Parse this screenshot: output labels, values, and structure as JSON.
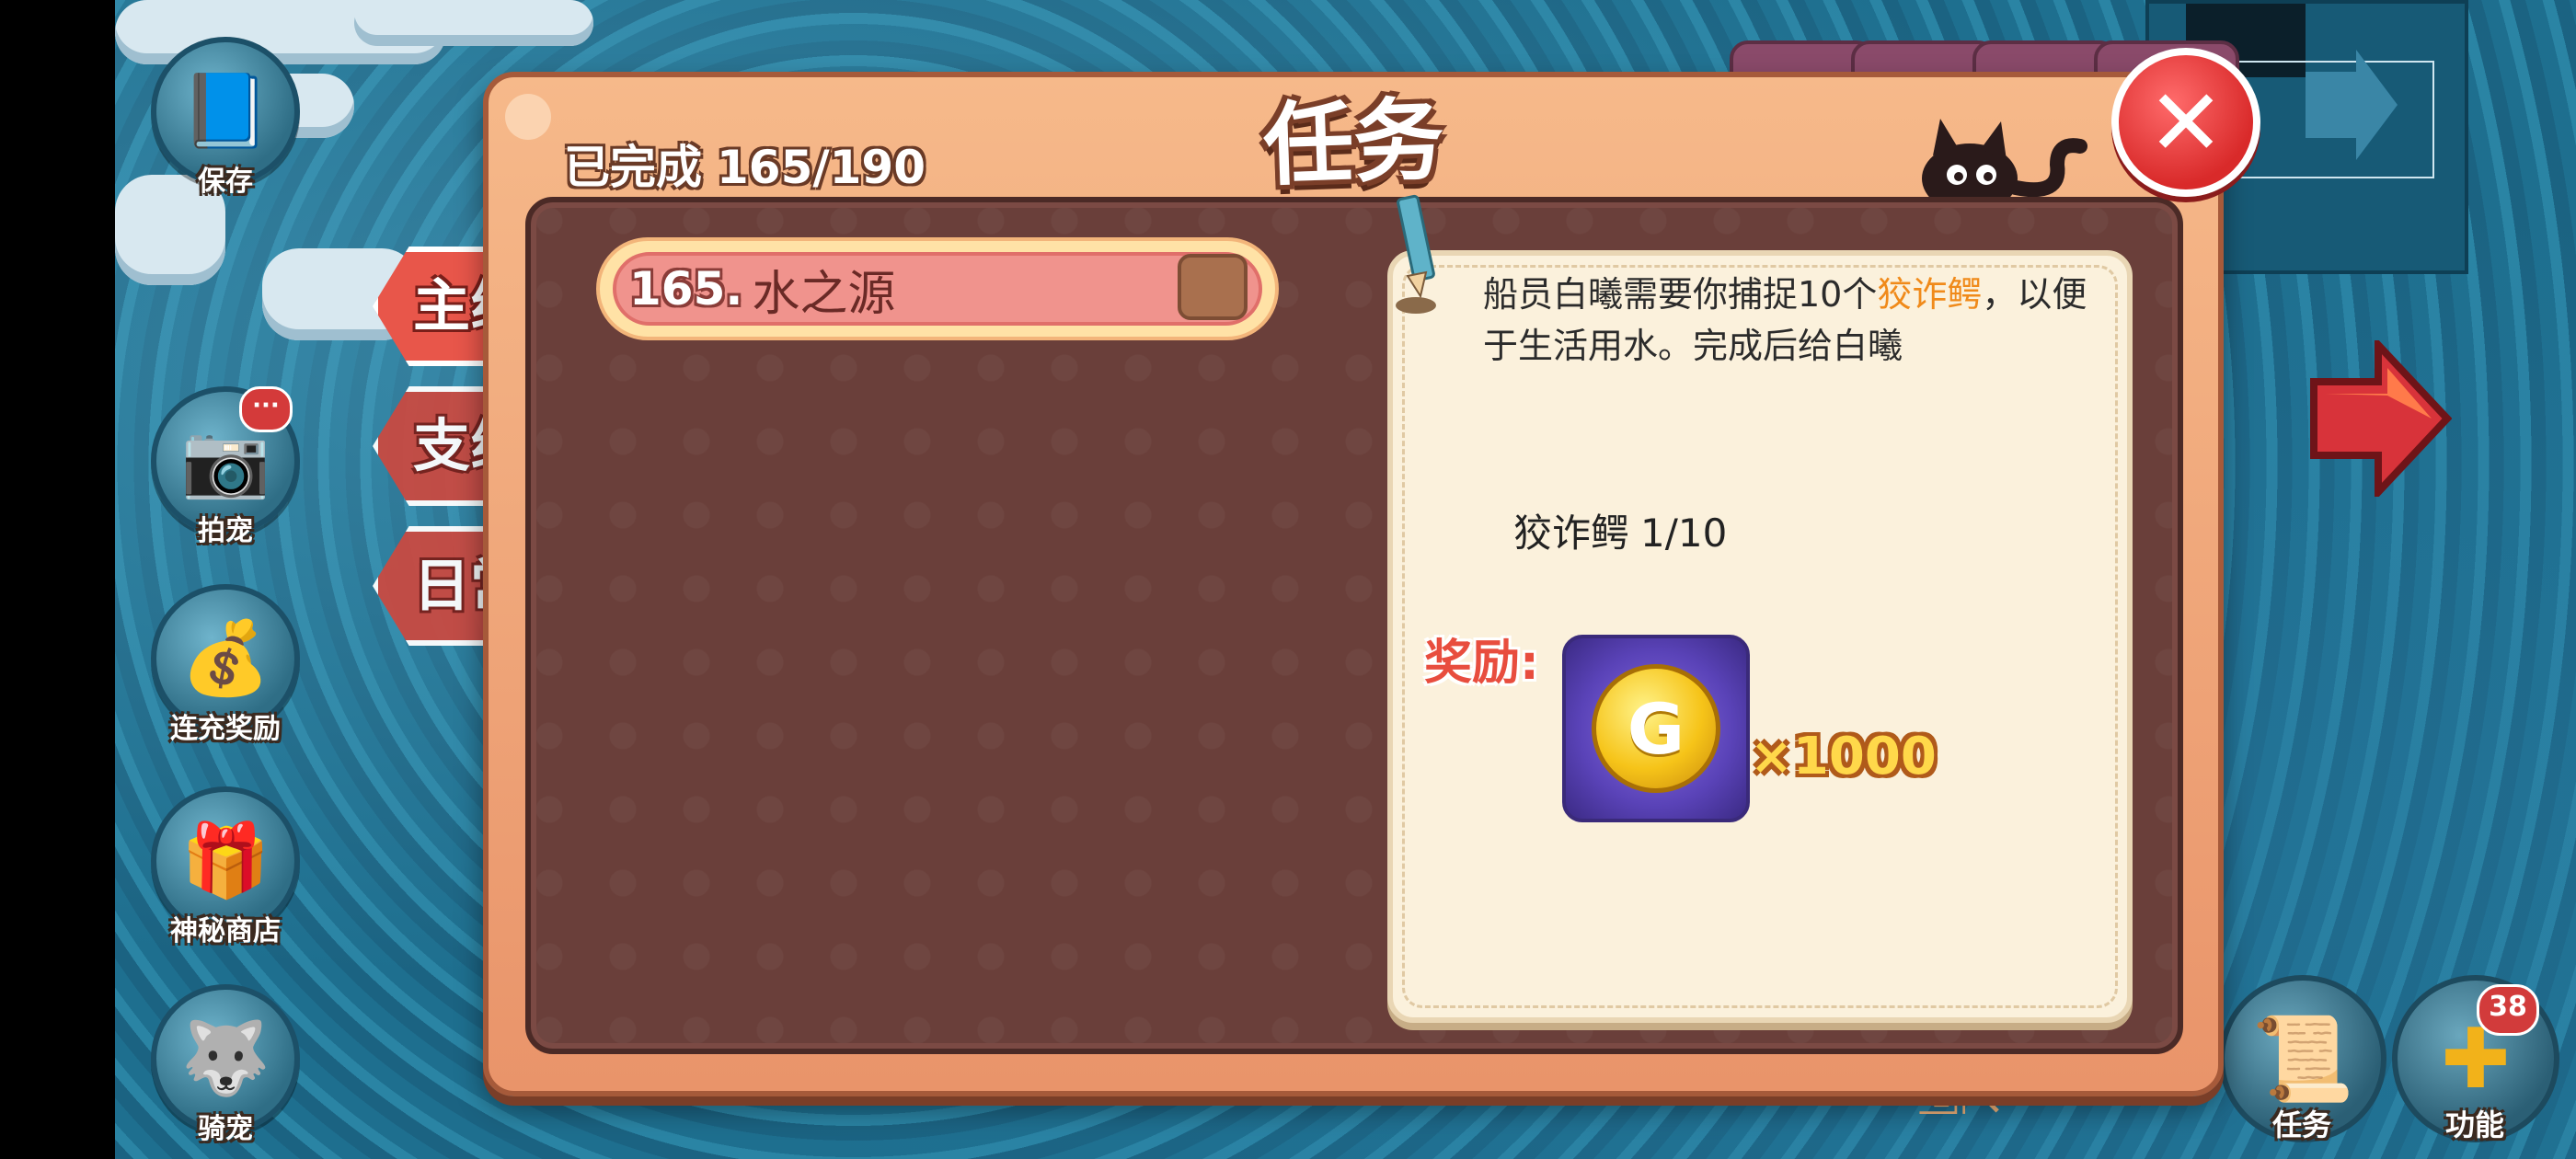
{
  "sidebar": {
    "items": [
      {
        "label": "保存",
        "icon": "book-icon"
      },
      {
        "label": "拍宠",
        "icon": "camera-icon"
      },
      {
        "label": "连充奖励",
        "icon": "treasure-icon"
      },
      {
        "label": "神秘商店",
        "icon": "shop-icon"
      },
      {
        "label": "骑宠",
        "icon": "mount-icon"
      }
    ],
    "notify_text": "···"
  },
  "panel": {
    "title": "任务",
    "progress_label": "已完成",
    "progress_value": "165/190",
    "close_label": "✕"
  },
  "tabs": [
    {
      "label": "主线"
    },
    {
      "label": "支线"
    },
    {
      "label": "日常"
    }
  ],
  "quest": {
    "number": "165.",
    "name": "水之源"
  },
  "description": {
    "text_before": "船员白曦需要你捕捉10个",
    "highlight": "狡诈鳄",
    "text_after": "，以便于生活用水。完成后给白曦",
    "progress_target": "狡诈鳄",
    "progress_count": "1/10"
  },
  "reward": {
    "label": "奖励:",
    "item_glyph": "G",
    "count": "×1000"
  },
  "bottom_right": {
    "task_label": "任务",
    "function_label": "功能",
    "badge": "38"
  },
  "colors": {
    "panel_accent": "#e9946a",
    "close_red": "#d92a2a",
    "highlight_orange": "#f08a1a",
    "reward_red": "#e84d3e"
  }
}
